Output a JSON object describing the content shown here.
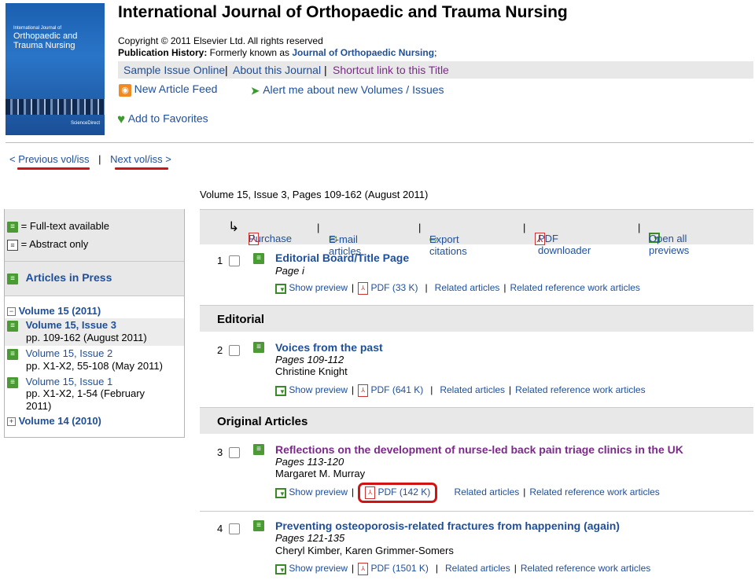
{
  "journal": {
    "cover": {
      "small": "International Journal of",
      "name": "Orthopaedic and Trauma Nursing",
      "publisher": "ScienceDirect"
    },
    "title": "International Journal of Orthopaedic and Trauma Nursing",
    "copyright": "Copyright © 2011 Elsevier Ltd. All rights reserved",
    "history_label": "Publication History:",
    "history_text": " Formerly known as ",
    "history_link": "Journal of Orthopaedic Nursing",
    "history_end": ";"
  },
  "linkbar": {
    "sample": "Sample Issue Online",
    "about": "About this Journal",
    "shortcut": "Shortcut link to this Title"
  },
  "feeds": {
    "rss": "New Article Feed",
    "alert": "Alert me about new Volumes / Issues",
    "favorites": "Add to Favorites"
  },
  "nav": {
    "prev": "< Previous vol/iss",
    "next": "Next vol/iss >"
  },
  "issue_header": "Volume 15, Issue 3, Pages 109-162 (August 2011)",
  "legend": {
    "full": " = Full-text available",
    "abstract": " = Abstract only"
  },
  "sidebar": {
    "in_press": "Articles in Press",
    "volume15": "Volume 15 (2011)",
    "issues": [
      {
        "name": "Volume 15, Issue 3",
        "pages": "pp. 109-162 (August 2011)"
      },
      {
        "name": "Volume 15, Issue 2",
        "pages": "pp. X1-X2, 55-108 (May 2011)"
      },
      {
        "name": "Volume 15, Issue 1",
        "pages": "pp. X1-X2, 1-54 (February",
        "pages2": "2011)"
      }
    ],
    "volume14": "Volume 14 (2010)"
  },
  "toolbar": {
    "purchase": "Purchase",
    "email": "E-mail articles",
    "export": "Export citations",
    "pdfdl": "PDF downloader",
    "open": "Open all previews"
  },
  "sections": {
    "editorial": "Editorial",
    "original": "Original Articles"
  },
  "actions": {
    "preview": "Show preview",
    "related": "Related articles",
    "related_ref": "Related reference work articles"
  },
  "articles": [
    {
      "num": "1",
      "title": "Editorial Board/Title Page",
      "pages": "Page i",
      "authors": "",
      "pdf": "PDF (33 K)"
    },
    {
      "num": "2",
      "title": "Voices from the past",
      "pages": "Pages 109-112",
      "authors": "Christine Knight",
      "pdf": "PDF (641 K)"
    },
    {
      "num": "3",
      "title": "Reflections on the development of nurse-led back pain triage clinics in the UK",
      "pages": "Pages 113-120",
      "authors": "Margaret M. Murray",
      "pdf": "PDF (142 K)"
    },
    {
      "num": "4",
      "title": "Preventing osteoporosis-related fractures from happening (again)",
      "pages": "Pages 121-135",
      "authors": "Cheryl Kimber, Karen Grimmer-Somers",
      "pdf": "PDF (1501 K)"
    }
  ]
}
